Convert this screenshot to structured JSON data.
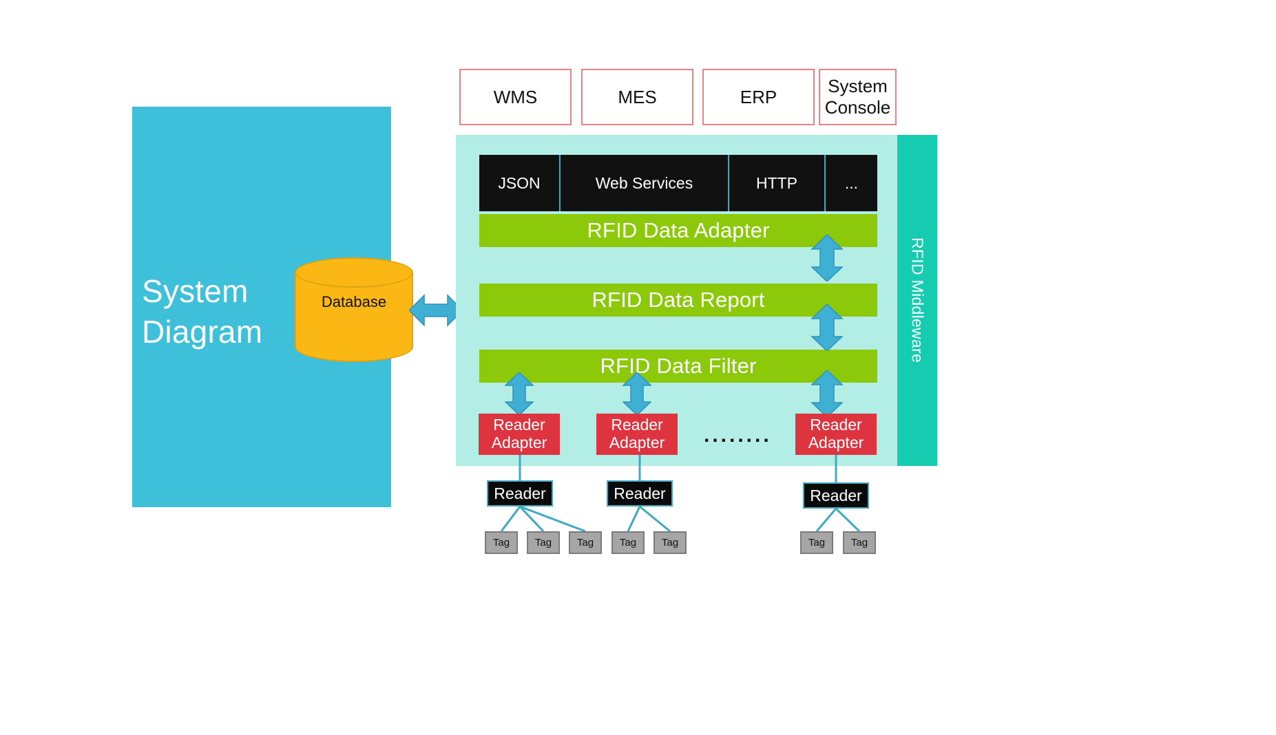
{
  "colors": {
    "left_panel": "#3FC0DA",
    "database": "#FBB714",
    "middleware_outer": "#B2EDE6",
    "middleware_side": "#15CCB0",
    "protocol_bar": "#111111",
    "layer_green": "#8CC90B",
    "reader_adapter_red": "#DD3440",
    "reader_black": "#0A0A0A",
    "tag_gray": "#A6A6A6",
    "arrow_blue": "#3FAFD4",
    "top_box_border": "#EF8080",
    "connector_blue": "#3FA9C4"
  },
  "left_panel": {
    "title": "System\nDiagram"
  },
  "database": {
    "label": "Database"
  },
  "arrows": {
    "db_to_middleware": "double-headed-horizontal-arrow",
    "adapter_report": "double-headed-vertical-arrow",
    "report_filter": "double-headed-vertical-arrow",
    "filter_readeradapter": "double-headed-vertical-arrow"
  },
  "top_systems": [
    {
      "label": "WMS"
    },
    {
      "label": "MES"
    },
    {
      "label": "ERP"
    },
    {
      "label": "System\nConsole"
    }
  ],
  "middleware": {
    "side_label": "RFID Middleware",
    "protocols": [
      {
        "label": "JSON"
      },
      {
        "label": "Web Services"
      },
      {
        "label": "HTTP"
      },
      {
        "label": "..."
      }
    ],
    "layers": [
      {
        "label": "RFID Data Adapter"
      },
      {
        "label": "RFID Data Report"
      },
      {
        "label": "RFID Data Filter"
      }
    ],
    "reader_adapters": [
      {
        "label": "Reader\nAdapter"
      },
      {
        "label": "Reader\nAdapter"
      },
      {
        "label": "Reader\nAdapter"
      }
    ],
    "ellipsis": "........"
  },
  "readers": [
    {
      "label": "Reader",
      "tags": [
        {
          "label": "Tag"
        },
        {
          "label": "Tag"
        },
        {
          "label": "Tag"
        }
      ]
    },
    {
      "label": "Reader",
      "tags": [
        {
          "label": "Tag"
        },
        {
          "label": "Tag"
        }
      ]
    },
    {
      "label": "Reader",
      "tags": [
        {
          "label": "Tag"
        },
        {
          "label": "Tag"
        }
      ]
    }
  ],
  "tags_flat": [
    {
      "label": "Tag"
    },
    {
      "label": "Tag"
    },
    {
      "label": "Tag"
    },
    {
      "label": "Tag"
    },
    {
      "label": "Tag"
    },
    {
      "label": "Tag"
    },
    {
      "label": "Tag"
    }
  ]
}
